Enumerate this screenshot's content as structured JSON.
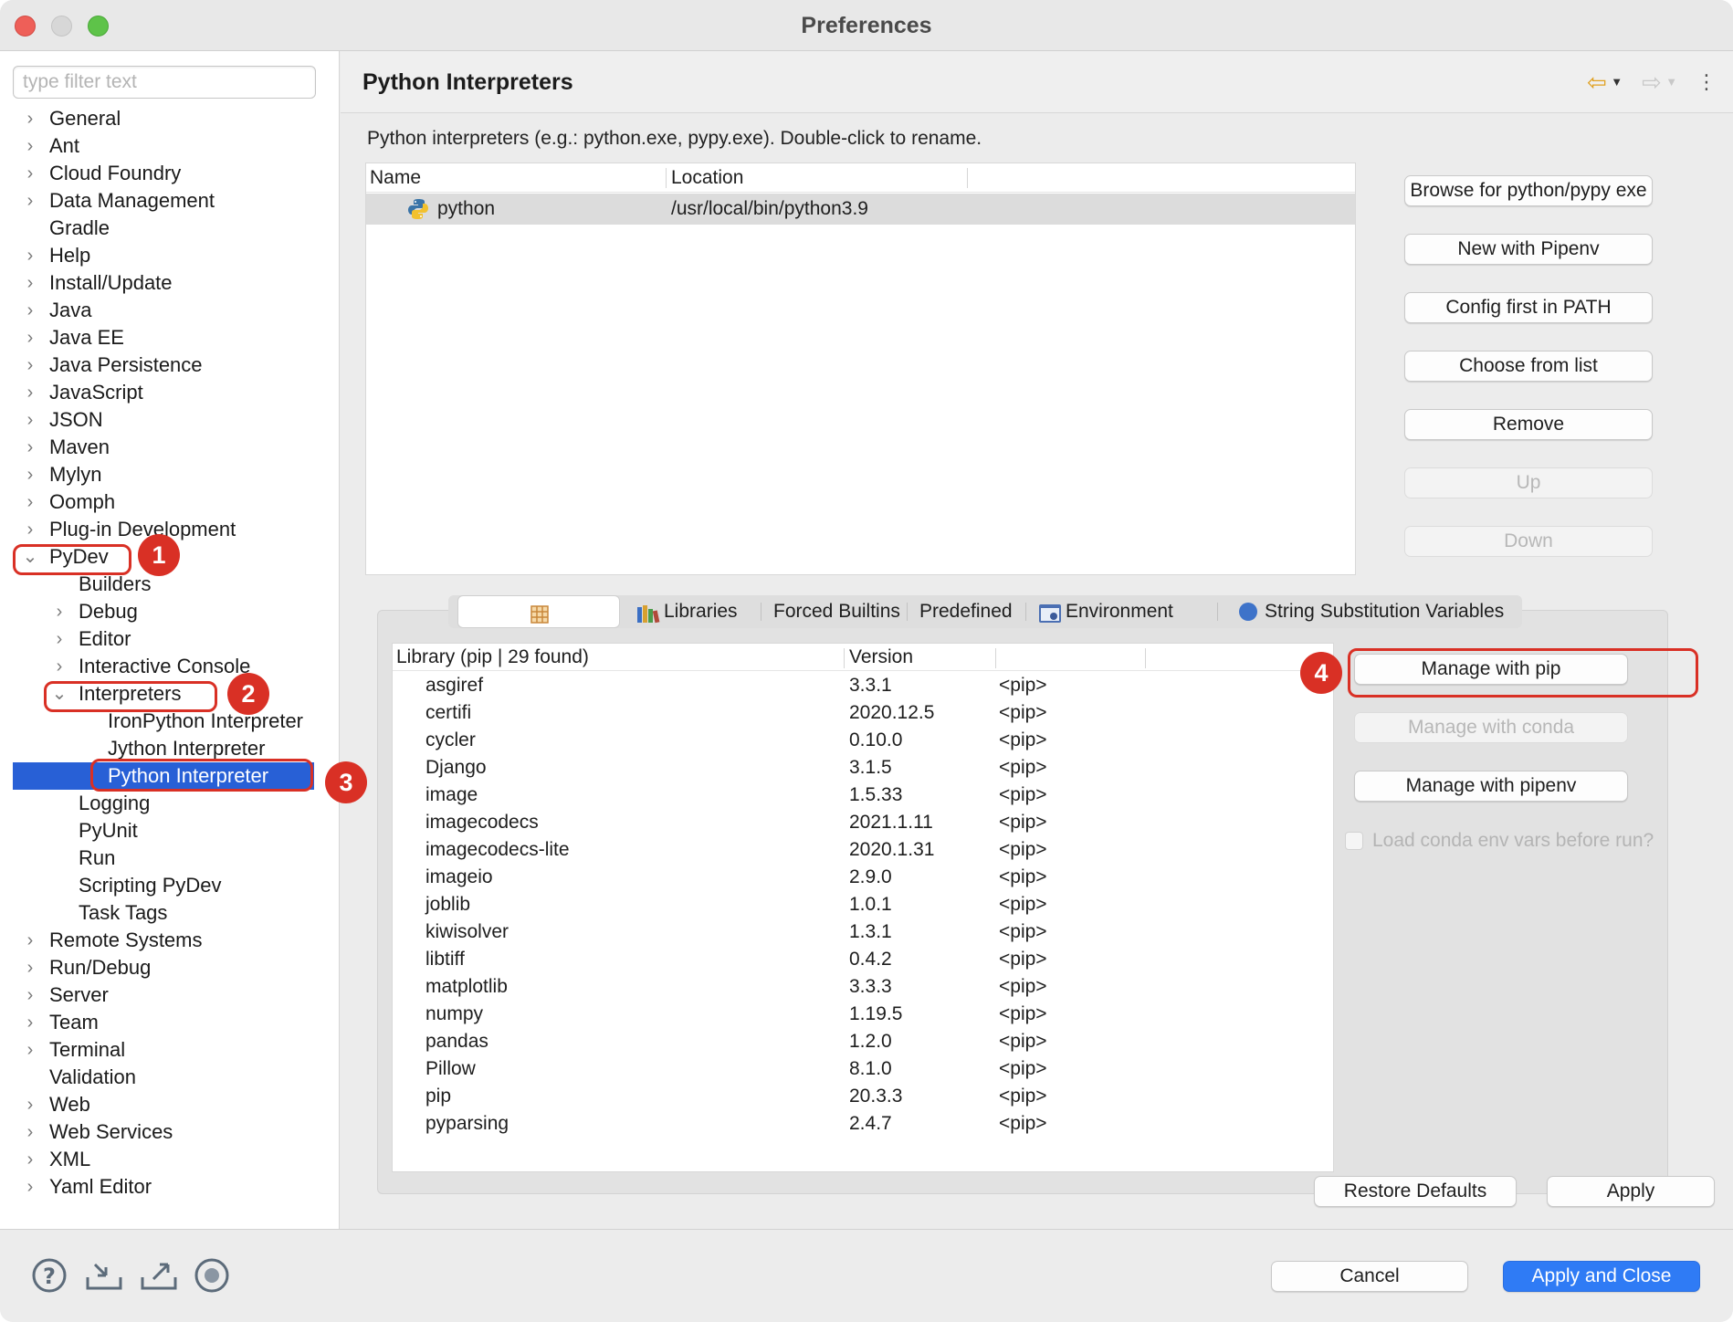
{
  "window": {
    "title": "Preferences"
  },
  "filter": {
    "placeholder": "type filter text"
  },
  "tree": {
    "top_items": [
      "General",
      "Ant",
      "Cloud Foundry",
      "Data Management",
      "Gradle",
      "Help",
      "Install/Update",
      "Java",
      "Java EE",
      "Java Persistence",
      "JavaScript",
      "JSON",
      "Maven",
      "Mylyn",
      "Oomph",
      "Plug-in Development"
    ],
    "pydev": "PyDev",
    "pydev_children": {
      "builders": "Builders",
      "debug": "Debug",
      "editor": "Editor",
      "interactive_console": "Interactive Console",
      "interpreters": "Interpreters"
    },
    "interpreter_children": {
      "iron": "IronPython Interpreter",
      "jython": "Jython Interpreter",
      "python": "Python Interpreter"
    },
    "pydev_after": [
      "Logging",
      "PyUnit",
      "Run",
      "Scripting PyDev",
      "Task Tags"
    ],
    "bottom_items": [
      "Remote Systems",
      "Run/Debug",
      "Server",
      "Team",
      "Terminal",
      "Validation",
      "Web",
      "Web Services",
      "XML",
      "Yaml Editor"
    ]
  },
  "page": {
    "title": "Python Interpreters",
    "description": "Python interpreters (e.g.: python.exe, pypy.exe).   Double-click to rename."
  },
  "interpreters_table": {
    "headers": {
      "name": "Name",
      "location": "Location"
    },
    "row": {
      "name": "python",
      "location": "/usr/local/bin/python3.9"
    }
  },
  "interpreter_buttons": {
    "browse": "Browse for python/pypy exe",
    "pipenv": "New with Pipenv",
    "config": "Config first in PATH",
    "choose": "Choose from list",
    "remove": "Remove",
    "up": "Up",
    "down": "Down"
  },
  "tabs": {
    "libraries": "Libraries",
    "forced_builtins": "Forced Builtins",
    "predefined": "Predefined",
    "environment": "Environment",
    "string_sub": "String Substitution Variables"
  },
  "lib_table": {
    "headers": {
      "library": "Library (pip | 29 found)",
      "version": "Version"
    },
    "rows": [
      {
        "name": "asgiref",
        "version": "3.3.1",
        "source": "<pip>"
      },
      {
        "name": "certifi",
        "version": "2020.12.5",
        "source": "<pip>"
      },
      {
        "name": "cycler",
        "version": "0.10.0",
        "source": "<pip>"
      },
      {
        "name": "Django",
        "version": "3.1.5",
        "source": "<pip>"
      },
      {
        "name": "image",
        "version": "1.5.33",
        "source": "<pip>"
      },
      {
        "name": "imagecodecs",
        "version": "2021.1.11",
        "source": "<pip>"
      },
      {
        "name": "imagecodecs-lite",
        "version": "2020.1.31",
        "source": "<pip>"
      },
      {
        "name": "imageio",
        "version": "2.9.0",
        "source": "<pip>"
      },
      {
        "name": "joblib",
        "version": "1.0.1",
        "source": "<pip>"
      },
      {
        "name": "kiwisolver",
        "version": "1.3.1",
        "source": "<pip>"
      },
      {
        "name": "libtiff",
        "version": "0.4.2",
        "source": "<pip>"
      },
      {
        "name": "matplotlib",
        "version": "3.3.3",
        "source": "<pip>"
      },
      {
        "name": "numpy",
        "version": "1.19.5",
        "source": "<pip>"
      },
      {
        "name": "pandas",
        "version": "1.2.0",
        "source": "<pip>"
      },
      {
        "name": "Pillow",
        "version": "8.1.0",
        "source": "<pip>"
      },
      {
        "name": "pip",
        "version": "20.3.3",
        "source": "<pip>"
      },
      {
        "name": "pyparsing",
        "version": "2.4.7",
        "source": "<pip>"
      }
    ]
  },
  "lib_buttons": {
    "pip": "Manage with pip",
    "conda": "Manage with conda",
    "pipenv": "Manage with pipenv",
    "conda_env_check": "Load conda env vars before run?"
  },
  "actions": {
    "restore_defaults": "Restore Defaults",
    "apply": "Apply",
    "cancel": "Cancel",
    "apply_close": "Apply and Close"
  },
  "annotations": [
    "1",
    "2",
    "3",
    "4"
  ],
  "colors": {
    "selection": "#2860d6",
    "annotation": "#d93025",
    "primary_button": "#2f7bf5"
  }
}
